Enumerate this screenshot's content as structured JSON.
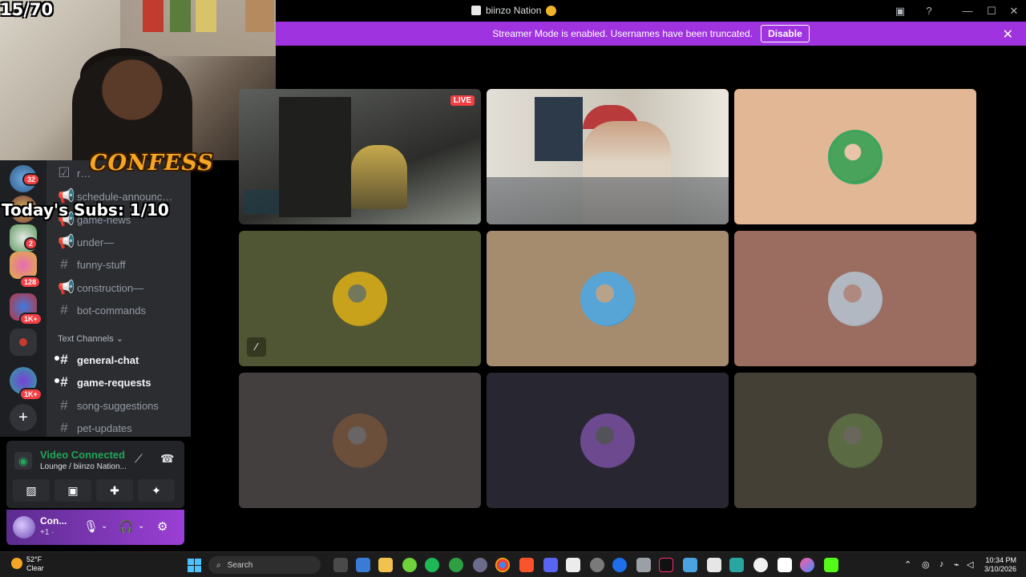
{
  "stream_overlay": {
    "counter": "15/70",
    "confess_label": "CONFESS",
    "subs_label": "Today's Subs: 1/10"
  },
  "window": {
    "title": "biinzo Nation",
    "minimize": "—",
    "maximize": "☐",
    "close": "✕"
  },
  "banner": {
    "message": "Streamer Mode is enabled. Usernames have been truncated.",
    "disable_label": "Disable",
    "close": "✕"
  },
  "servers": {
    "badges": [
      "32",
      "2",
      "128",
      "1K+",
      "1K+"
    ],
    "add": "+"
  },
  "channels": {
    "items": [
      {
        "label": "r…",
        "type": "text"
      },
      {
        "label": "schedule-announc…",
        "type": "announcement"
      },
      {
        "label": "game-news",
        "type": "announcement"
      },
      {
        "label": "under—",
        "type": "announcement"
      },
      {
        "label": "funny-stuff",
        "type": "text"
      },
      {
        "label": "construction—",
        "type": "announcement"
      },
      {
        "label": "bot-commands",
        "type": "text"
      }
    ],
    "category": "Text Channels ⌄",
    "text_items": [
      {
        "label": "general-chat",
        "unread": true
      },
      {
        "label": "game-requests",
        "unread": true
      },
      {
        "label": "song-suggestions",
        "unread": false
      },
      {
        "label": "pet-updates",
        "unread": false
      }
    ]
  },
  "voice": {
    "status": "Video Connected",
    "location": "Lounge / biinzo Nation..."
  },
  "user": {
    "name": "Con...",
    "status": "+1 ·"
  },
  "grid": {
    "live_label": "LIVE",
    "tiles": [
      {
        "bg": "#3a3c3b",
        "kind": "game"
      },
      {
        "bg": "#b9b3aa",
        "kind": "camera"
      },
      {
        "bg": "#e2b795",
        "kind": "avatar",
        "avatar_color": "#4aa35a"
      },
      {
        "bg": "#505634",
        "kind": "avatar",
        "avatar_color": "#c9a21c",
        "muted": true
      },
      {
        "bg": "#a58c6e",
        "kind": "avatar",
        "avatar_color": "#57a5d6"
      },
      {
        "bg": "#9b6c60",
        "kind": "avatar",
        "avatar_color": "#b2b8c2"
      },
      {
        "bg": "#433f3f",
        "kind": "avatar",
        "avatar_color": "#6b4f3a"
      },
      {
        "bg": "#282631",
        "kind": "avatar",
        "avatar_color": "#6d4a8f"
      },
      {
        "bg": "#444036",
        "kind": "avatar",
        "avatar_color": "#5a6b44"
      }
    ]
  },
  "taskbar": {
    "temp": "52°F",
    "weather": "Clear",
    "search_placeholder": "Search",
    "time": "10:34 PM",
    "date": "3/10/2026"
  }
}
